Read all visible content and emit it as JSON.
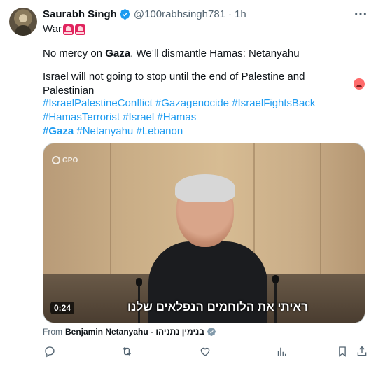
{
  "author": {
    "display_name": "Saurabh Singh",
    "handle": "@100rabhsingh781",
    "separator": "·",
    "time": "1h"
  },
  "post": {
    "line1_text": "War",
    "line2_prefix": "No mercy on ",
    "line2_bold": "Gaza",
    "line2_suffix": ". We’ll dismantle Hamas: Netanyahu",
    "line3_text": "Israel will not going to stop until the end of Palestine and Palestinian",
    "hashtags_row1": [
      "#IsraelPalestineConflict",
      "#Gazagenocide",
      "#IsraelFightsBack"
    ],
    "hashtags_row2": [
      "#HamasTerrorist",
      "#Israel",
      "#Hamas"
    ],
    "hashtags_row3": [
      "#Gaza",
      "#Netanyahu",
      "#Lebanon"
    ]
  },
  "media": {
    "watermark": "GPO",
    "subtitle": "ראיתי את הלוחמים הנפלאים שלנו",
    "duration": "0:24"
  },
  "source": {
    "label": "From",
    "name": "Benjamin Netanyahu - בנימין נתניהו"
  },
  "icons": {
    "verified": "verified-badge-icon",
    "more": "more-icon",
    "reply": "reply-icon",
    "repost": "repost-icon",
    "like": "like-icon",
    "views": "views-icon",
    "bookmark": "bookmark-icon",
    "share": "share-icon"
  },
  "colors": {
    "accent": "#1d9bf0",
    "text_primary": "#0f1419",
    "text_secondary": "#536471"
  }
}
